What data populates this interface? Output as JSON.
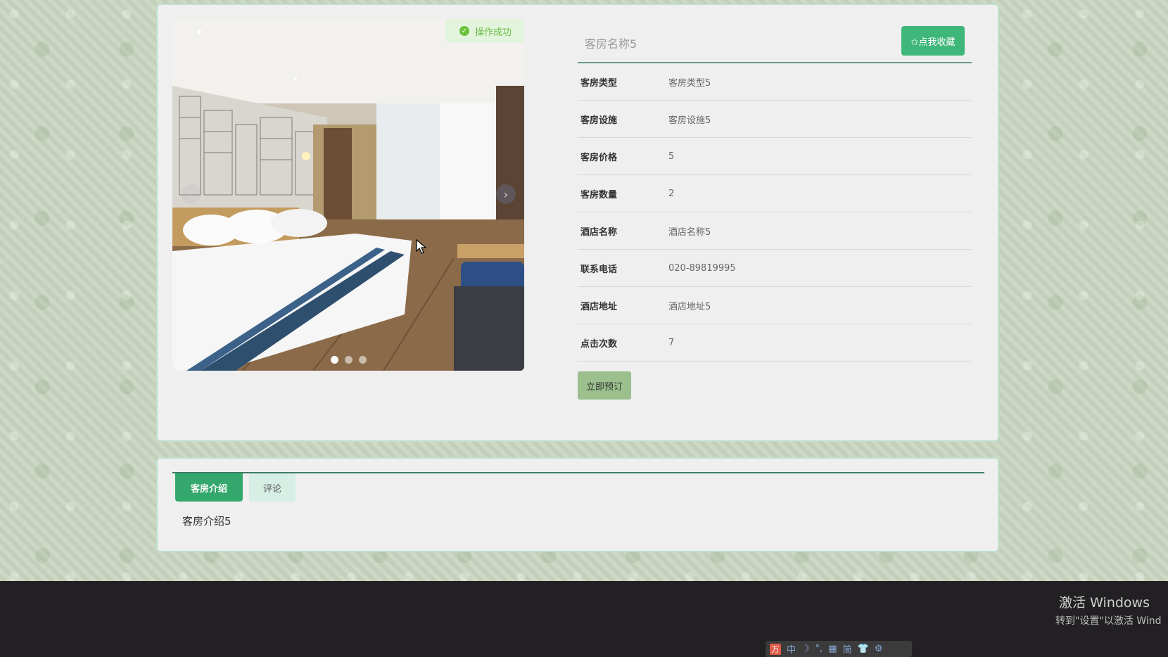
{
  "toast": {
    "text": "操作成功",
    "icon": "check-circle-icon"
  },
  "room": {
    "name": "客房名称5",
    "favorite_label": "✩点我收藏",
    "fields": [
      {
        "label": "客房类型",
        "value": "客房类型5"
      },
      {
        "label": "客房设施",
        "value": "客房设施5"
      },
      {
        "label": "客房价格",
        "value": "5"
      },
      {
        "label": "客房数量",
        "value": "2"
      },
      {
        "label": "酒店名称",
        "value": "酒店名称5"
      },
      {
        "label": "联系电话",
        "value": "020-89819995"
      },
      {
        "label": "酒店地址",
        "value": "酒店地址5"
      },
      {
        "label": "点击次数",
        "value": "7"
      }
    ],
    "book_label": "立即预订"
  },
  "carousel": {
    "slide_count": 3,
    "active_index": 0
  },
  "tabs": [
    {
      "label": "客房介绍",
      "active": true
    },
    {
      "label": "评论",
      "active": false
    }
  ],
  "intro": "客房介绍5",
  "windows": {
    "activate_title": "激活 Windows",
    "activate_sub": "转到\"设置\"以激活 Wind"
  },
  "ime": {
    "logo": "万",
    "items": [
      "中",
      "☽",
      "°,",
      "▦",
      "简",
      "👕",
      "⚙"
    ]
  },
  "colors": {
    "accent": "#3fb67a",
    "tab_active": "#34a86c",
    "book": "#9bc08e"
  }
}
